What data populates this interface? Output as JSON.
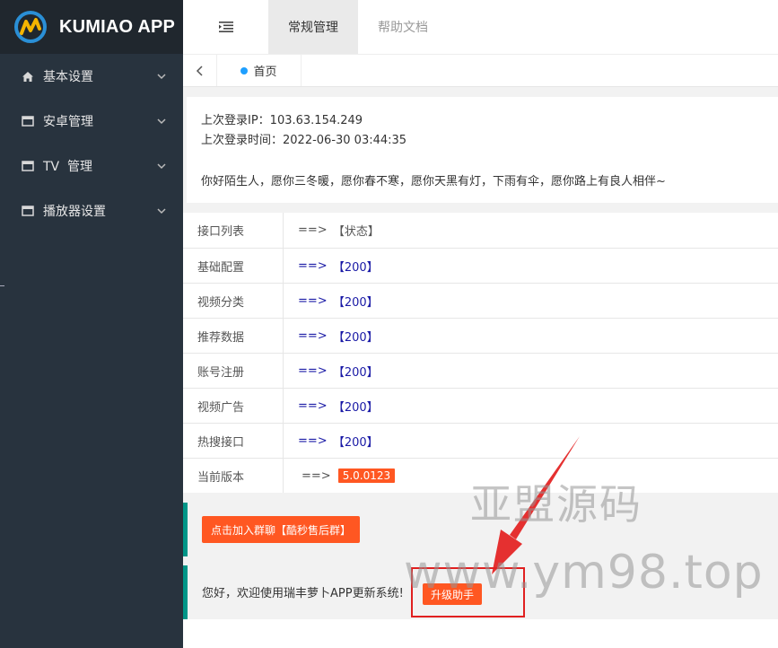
{
  "app": {
    "title": "KUMIAO APP"
  },
  "sidebar": {
    "items": [
      {
        "label": "基本设置",
        "icon": "home-icon"
      },
      {
        "label": "安卓管理",
        "icon": "window-icon"
      },
      {
        "label": "TV  管理",
        "icon": "window-icon"
      },
      {
        "label": "播放器设置",
        "icon": "window-icon"
      }
    ]
  },
  "header": {
    "tabs": [
      {
        "label": "常规管理",
        "active": true
      },
      {
        "label": "帮助文档",
        "active": false
      }
    ]
  },
  "breadcrumb": {
    "home_label": "首页"
  },
  "info": {
    "last_ip": "上次登录IP：103.63.154.249",
    "last_time": "上次登录时间：2022-06-30 03:44:35",
    "greeting": "你好陌生人，愿你三冬暖，愿你春不寒，愿你天黑有灯，下雨有伞，愿你路上有良人相伴~"
  },
  "table": {
    "rows": [
      {
        "label": "接口列表",
        "arrow": "==>",
        "value": "【状态】"
      },
      {
        "label": "基础配置",
        "arrow": "==>",
        "value": "【200】"
      },
      {
        "label": "视频分类",
        "arrow": "==>",
        "value": "【200】"
      },
      {
        "label": "推荐数据",
        "arrow": "==>",
        "value": "【200】"
      },
      {
        "label": "账号注册",
        "arrow": "==>",
        "value": "【200】"
      },
      {
        "label": "视频广告",
        "arrow": "==>",
        "value": "【200】"
      },
      {
        "label": "热搜接口",
        "arrow": "==>",
        "value": "【200】"
      }
    ],
    "version_row": {
      "label": "当前版本",
      "arrow": "==>",
      "version": "5.0.0123"
    }
  },
  "join": {
    "button_label": "点击加入群聊【酷秒售后群】"
  },
  "update": {
    "welcome": "您好，欢迎使用瑞丰萝卜APP更新系统!",
    "button_label": "升级助手"
  },
  "watermark": {
    "cn": "亚盟源码",
    "url": "www.ym98.top"
  },
  "colors": {
    "sidebar": "#28333e",
    "logo_bar": "#20272e",
    "accent_orange": "#ff5722",
    "quote_border": "#009688",
    "value_blue": "#1a1aa6"
  }
}
